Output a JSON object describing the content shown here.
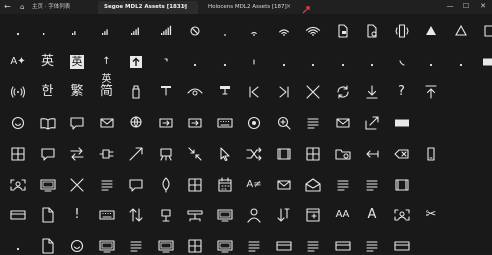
{
  "window": {
    "back_glyph": "←",
    "home_glyph": "⌂",
    "breadcrumb": "主页 · 字体列表",
    "tabs": [
      {
        "label": "Segoe MDL2 Assets [1831]",
        "close": "×",
        "active": true
      },
      {
        "label": "Holocens MDL2 Assets [187]",
        "close": "×",
        "active": false
      }
    ],
    "new_tab_icon": "add-tab-icon",
    "controls": {
      "minimize": "—",
      "maximize": "☐",
      "close": "✕"
    }
  },
  "accent": "#ff3b3b",
  "glyph_rows": [
    [
      {
        "name": "bullet-icon",
        "k": "dot"
      },
      {
        "name": "signal-bars-1-icon",
        "k": "bars",
        "t": "1"
      },
      {
        "name": "signal-bars-2-icon",
        "k": "bars",
        "t": "2"
      },
      {
        "name": "signal-bars-3-icon",
        "k": "bars",
        "t": "3"
      },
      {
        "name": "signal-bars-4-icon",
        "k": "bars",
        "t": "4"
      },
      {
        "name": "signal-bars-5-icon",
        "k": "bars",
        "t": "5"
      },
      {
        "name": "blocked-icon",
        "k": "blocked"
      },
      {
        "name": "wifi-1-icon",
        "k": "wifi",
        "t": "1"
      },
      {
        "name": "wifi-2-icon",
        "k": "wifi",
        "t": "2"
      },
      {
        "name": "wifi-3-icon",
        "k": "wifi",
        "t": "3"
      },
      {
        "name": "wifi-4-icon",
        "k": "wifi",
        "t": "4"
      },
      {
        "name": "locked-doc-icon",
        "k": "lockdoc"
      },
      {
        "name": "settings-doc-icon",
        "k": "gear"
      },
      {
        "name": "phone-vibrate-icon",
        "k": "vibrate"
      },
      {
        "name": "triangle-filled-icon",
        "k": "triangle",
        "t": "fill"
      },
      {
        "name": "triangle-outline-icon",
        "k": "triangle",
        "t": "line"
      },
      {
        "name": "square-outline-icon",
        "k": "square",
        "t": "line"
      }
    ],
    [
      {
        "name": "sparkle-a-icon",
        "k": "text",
        "t": "A✦"
      },
      {
        "name": "chinese-ying-icon",
        "k": "text",
        "t": "英"
      },
      {
        "name": "chinese-ying-box-icon",
        "k": "textbox",
        "t": "英"
      },
      {
        "name": "chinese-ying-arrow-icon",
        "k": "text",
        "t": "↑英"
      },
      {
        "name": "up-arrow-box-icon",
        "k": "uparrowbox"
      },
      {
        "name": "corner-arrow-icon",
        "k": "corner"
      },
      {
        "name": "small-dot-icon",
        "k": "dot"
      },
      {
        "name": "small-dot-icon",
        "k": "dot"
      },
      {
        "name": "tick-mark-icon",
        "k": "tick"
      },
      {
        "name": "small-dot-icon",
        "k": "dot"
      },
      {
        "name": "small-dot-icon",
        "k": "dot"
      },
      {
        "name": "small-dot-icon",
        "k": "dot"
      },
      {
        "name": "small-dot-icon",
        "k": "dot"
      },
      {
        "name": "phone-icon",
        "k": "phone"
      },
      {
        "name": "small-dot-icon",
        "k": "dot"
      },
      {
        "name": "small-dot-icon",
        "k": "dot"
      },
      {
        "name": "filled-rectangle-icon",
        "k": "rectfill"
      }
    ],
    [
      {
        "name": "broadcast-icon",
        "k": "broadcast"
      },
      {
        "name": "korean-han-icon",
        "k": "text",
        "t": "한"
      },
      {
        "name": "chinese-fan-icon",
        "k": "text",
        "t": "繁"
      },
      {
        "name": "chinese-jian-icon",
        "k": "text",
        "t": "简"
      },
      {
        "name": "usb-stick-icon",
        "k": "usb"
      },
      {
        "name": "pin-top-icon",
        "k": "pin"
      },
      {
        "name": "eye-icon",
        "k": "eye"
      },
      {
        "name": "pin-fill-icon",
        "k": "pinfill"
      },
      {
        "name": "previous-track-icon",
        "k": "prev"
      },
      {
        "name": "next-track-icon",
        "k": "next"
      },
      {
        "name": "close-x-icon",
        "k": "x"
      },
      {
        "name": "sync-icon",
        "k": "sync"
      },
      {
        "name": "download-icon",
        "k": "download"
      },
      {
        "name": "help-icon",
        "k": "text",
        "t": "?"
      },
      {
        "name": "upload-top-icon",
        "k": "upload"
      },
      {
        "name": "empty-icon",
        "k": "none"
      },
      {
        "name": "empty-icon",
        "k": "none"
      }
    ],
    [
      {
        "name": "emoji-icon",
        "k": "emoji"
      },
      {
        "name": "open-book-icon",
        "k": "book"
      },
      {
        "name": "comment-icon",
        "k": "comment"
      },
      {
        "name": "mail-icon",
        "k": "mail"
      },
      {
        "name": "globe-download-icon",
        "k": "globe"
      },
      {
        "name": "import-icon",
        "k": "import"
      },
      {
        "name": "export-box-icon",
        "k": "import"
      },
      {
        "name": "keyboard-icon",
        "k": "keyboard"
      },
      {
        "name": "camera-rotate-icon",
        "k": "camera"
      },
      {
        "name": "zoom-icon",
        "k": "zoom"
      },
      {
        "name": "list-lines-icon",
        "k": "lines"
      },
      {
        "name": "mail-fill-icon",
        "k": "mail"
      },
      {
        "name": "share-icon",
        "k": "share"
      },
      {
        "name": "white-rectangle-icon",
        "k": "rectfill"
      },
      {
        "name": "empty-icon",
        "k": "none"
      },
      {
        "name": "empty-icon",
        "k": "none"
      },
      {
        "name": "empty-icon",
        "k": "none"
      }
    ],
    [
      {
        "name": "grid-icon",
        "k": "grid"
      },
      {
        "name": "message-icon",
        "k": "comment"
      },
      {
        "name": "swap-arrows-icon",
        "k": "swap"
      },
      {
        "name": "video-input-icon",
        "k": "cable"
      },
      {
        "name": "diagonal-arrow-icon",
        "k": "diag"
      },
      {
        "name": "easel-icon",
        "k": "easel"
      },
      {
        "name": "collapse-arrows-icon",
        "k": "collapse"
      },
      {
        "name": "cursor-icon",
        "k": "cursor"
      },
      {
        "name": "shuffle-icon",
        "k": "shuffle"
      },
      {
        "name": "film-icon",
        "k": "film"
      },
      {
        "name": "table-icon",
        "k": "grid"
      },
      {
        "name": "folder-share-icon",
        "k": "foldershare"
      },
      {
        "name": "arrow-left-bar-icon",
        "k": "arrowleft"
      },
      {
        "name": "backspace-icon",
        "k": "backspace"
      },
      {
        "name": "phone-outline-icon",
        "k": "phoneout"
      },
      {
        "name": "empty-icon",
        "k": "none"
      },
      {
        "name": "empty-icon",
        "k": "none"
      }
    ],
    [
      {
        "name": "contact-frame-icon",
        "k": "contact"
      },
      {
        "name": "monitor-icon",
        "k": "monitor"
      },
      {
        "name": "close-x-icon",
        "k": "x"
      },
      {
        "name": "list-icon",
        "k": "lines"
      },
      {
        "name": "chat-bubble-icon",
        "k": "comment"
      },
      {
        "name": "leaf-icon",
        "k": "leaf"
      },
      {
        "name": "keypad-icon",
        "k": "grid"
      },
      {
        "name": "calendar-icon",
        "k": "calendar"
      },
      {
        "name": "font-sparkle-icon",
        "k": "text",
        "t": "A≠"
      },
      {
        "name": "mail-read-icon",
        "k": "mail"
      },
      {
        "name": "open-envelope-icon",
        "k": "envelope"
      },
      {
        "name": "horizontal-lines-icon",
        "k": "lines"
      },
      {
        "name": "dash-lines-icon",
        "k": "lines"
      },
      {
        "name": "film-strip-icon",
        "k": "film"
      },
      {
        "name": "empty-icon",
        "k": "none"
      },
      {
        "name": "empty-icon",
        "k": "none"
      },
      {
        "name": "empty-icon",
        "k": "none"
      }
    ],
    [
      {
        "name": "payment-card-icon",
        "k": "card"
      },
      {
        "name": "document-icon",
        "k": "doc"
      },
      {
        "name": "alert-icon",
        "k": "text",
        "t": "!"
      },
      {
        "name": "keyboard-box-icon",
        "k": "keyboard"
      },
      {
        "name": "sort-arrows-icon",
        "k": "sort"
      },
      {
        "name": "device-stand-icon",
        "k": "stand"
      },
      {
        "name": "network-icon",
        "k": "network"
      },
      {
        "name": "tab-panel-icon",
        "k": "monitor"
      },
      {
        "name": "person-icon",
        "k": "person"
      },
      {
        "name": "sort-down-icon",
        "k": "sortdown"
      },
      {
        "name": "tab-box-icon",
        "k": "tabbox"
      },
      {
        "name": "font-size-icon",
        "k": "text",
        "t": "A𝖠"
      },
      {
        "name": "font-outline-icon",
        "k": "text",
        "t": "A"
      },
      {
        "name": "contact-card-icon",
        "k": "contact"
      },
      {
        "name": "scissors-icon",
        "k": "text",
        "t": "✂"
      },
      {
        "name": "empty-icon",
        "k": "none"
      },
      {
        "name": "empty-icon",
        "k": "none"
      }
    ],
    [
      {
        "name": "partial-glyph-icon",
        "k": "dot"
      },
      {
        "name": "partial-doc-icon",
        "k": "doc"
      },
      {
        "name": "partial-globe-icon",
        "k": "emoji"
      },
      {
        "name": "partial-rect-icon",
        "k": "monitor"
      },
      {
        "name": "partial-line-icon",
        "k": "lines"
      },
      {
        "name": "partial-rect-icon",
        "k": "monitor"
      },
      {
        "name": "partial-grid-icon",
        "k": "grid"
      },
      {
        "name": "partial-rect-icon",
        "k": "monitor"
      },
      {
        "name": "partial-line-icon",
        "k": "lines"
      },
      {
        "name": "partial-shape-icon",
        "k": "card"
      },
      {
        "name": "partial-line-icon",
        "k": "lines"
      },
      {
        "name": "partial-shape-icon",
        "k": "card"
      },
      {
        "name": "partial-line-icon",
        "k": "lines"
      },
      {
        "name": "partial-shape-icon",
        "k": "card"
      },
      {
        "name": "empty-icon",
        "k": "none"
      },
      {
        "name": "empty-icon",
        "k": "none"
      },
      {
        "name": "empty-icon",
        "k": "none"
      }
    ]
  ]
}
